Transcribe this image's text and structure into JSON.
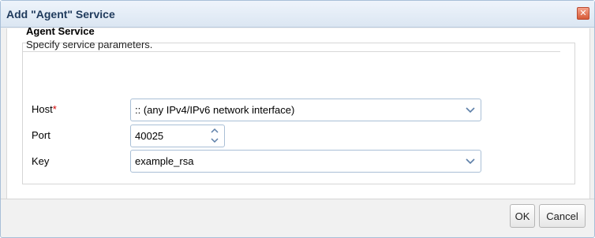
{
  "dialog": {
    "title": "Add \"Agent\" Service",
    "close_label": "✕"
  },
  "section": {
    "title": "Agent Service",
    "description": "Specify service parameters."
  },
  "form": {
    "host": {
      "label": "Host",
      "required_mark": "*",
      "value": ":: (any IPv4/IPv6 network interface)"
    },
    "port": {
      "label": "Port",
      "value": "40025"
    },
    "key": {
      "label": "Key",
      "value": "example_rsa"
    }
  },
  "buttons": {
    "ok": "OK",
    "cancel": "Cancel"
  },
  "icons": {
    "close": "close-icon",
    "dropdown": "chevron-down-icon",
    "spin_up": "chevron-up-icon",
    "spin_down": "chevron-down-icon"
  },
  "colors": {
    "title_text": "#1f3a5c",
    "required": "#d00000",
    "close_button": "#d65a36",
    "input_border": "#a9bfd6"
  }
}
